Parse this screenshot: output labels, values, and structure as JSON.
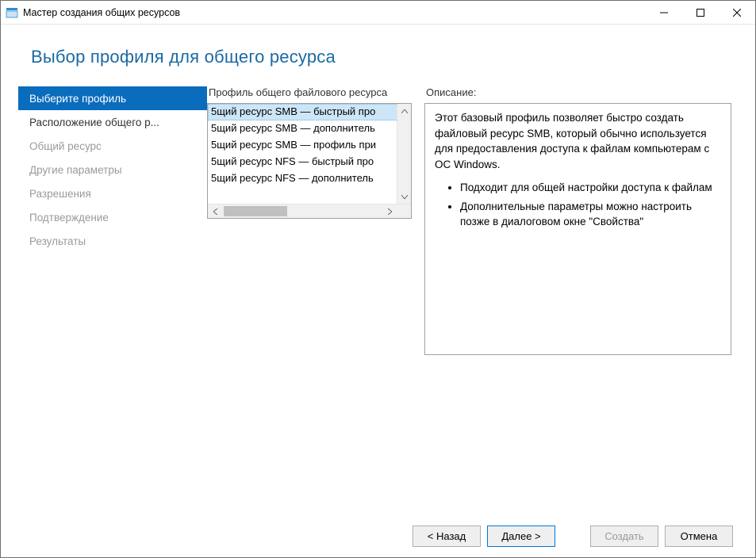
{
  "window": {
    "title": "Мастер создания общих ресурсов"
  },
  "page": {
    "heading": "Выбор профиля для общего ресурса"
  },
  "steps": [
    {
      "label": "Выберите профиль",
      "state": "active"
    },
    {
      "label": "Расположение общего р...",
      "state": "done"
    },
    {
      "label": "Общий ресурс",
      "state": "disabled"
    },
    {
      "label": "Другие параметры",
      "state": "disabled"
    },
    {
      "label": "Разрешения",
      "state": "disabled"
    },
    {
      "label": "Подтверждение",
      "state": "disabled"
    },
    {
      "label": "Результаты",
      "state": "disabled"
    }
  ],
  "listHeader": "Профиль общего файлового ресурса",
  "listItems": [
    "5щий ресурс SMB — быстрый про",
    "5щий ресурс SMB — дополнитель",
    "5щий ресурс SMB — профиль при",
    "5щий ресурс NFS — быстрый про",
    "5щий ресурс NFS — дополнитель"
  ],
  "descHeader": "Описание:",
  "description": {
    "para": "Этот базовый профиль позволяет быстро создать файловый ресурс SMB, который обычно используется для предоставления доступа к файлам компьютерам с ОС Windows.",
    "bullets": [
      "Подходит для общей настройки доступа к файлам",
      "Дополнительные параметры можно настроить позже в диалоговом окне \"Свойства\""
    ]
  },
  "buttons": {
    "back": "< Назад",
    "next": "Далее >",
    "create": "Создать",
    "cancel": "Отмена"
  }
}
